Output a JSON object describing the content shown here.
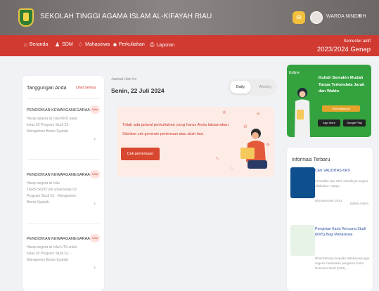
{
  "header": {
    "campus_name": "SEKOLAH TINGGI AGAMA ISLAM AL-KIFAYAH RIAU",
    "user_name": "WARDA NINGSIH",
    "dropdown_icon": "chevron-down-icon"
  },
  "nav": {
    "items": [
      {
        "label": "Beranda",
        "icon": "home-icon"
      },
      {
        "label": "SDM",
        "icon": "person-icon"
      },
      {
        "label": "Mahasiswa",
        "icon": "users-icon"
      },
      {
        "label": "Perkuliahan",
        "icon": "graduation-cap-icon"
      },
      {
        "label": "Laporan",
        "icon": "printer-icon"
      }
    ],
    "semester_label": "Semester aktif",
    "semester_value": "2023/2024 Genap"
  },
  "tanggungan": {
    "title": "Tanggungan Anda",
    "link": "Lihat Semua",
    "items": [
      {
        "name": "PENDIDIKAN KEWARGANEGARAAN",
        "desc": "Harap segera isi nilai MKD pada kelas 02 Program Studi S1 - Manajemen Bisnis Syariah",
        "badge": "Nilai"
      },
      {
        "name": "PENDIDIKAN KEWARGANEGARAAN",
        "desc": "Harap segera isi nilai TERSTRUKTUR untuk kelas 02 Program Studi S1 - Manajemen Bisnis Syariah",
        "badge": "Nilai"
      },
      {
        "name": "PENDIDIKAN KEWARGANEGARAAN",
        "desc": "Harap segera isi nilai UTS untuk kelas 02 Program Studi S1 - Manajemen Bisnis Syariah",
        "badge": "Nilai"
      }
    ]
  },
  "jadwal": {
    "label": "Jadwal Hari Ini",
    "date": "Senin, 22 Juli 2024",
    "toggle": [
      "Daily",
      "Weekly"
    ],
    "empty_title": "Tidak ada jadwal perkuliahan yang harus Anda laksanakan.",
    "empty_sub": "Silahkan cek generate pertemuan atau ubah hari.",
    "button": "Cek pertemuan"
  },
  "banner": {
    "logo": "Edlink",
    "title": "Kuliah Semakin Mudah Tanpa Terkendala Jarak dan Waktu",
    "button": "Selengkapnya",
    "app_store": "App Store",
    "google_play": "Google Play"
  },
  "informasi": {
    "title": "Informasi Terbaru",
    "items": [
      {
        "title": "CEK VALIDITAS KRS",
        "summary": "Perwalian dan KRS sebaiknya segera dilakukan. Harap...",
        "date": "06 Desember 2023",
        "by": "Edlink Admin"
      },
      {
        "title": "Pengisian Kartu Rencana Studi (KRS) Bagi Mahasiswa",
        "summary": "Diberitahukan kepada Mahasiswa agar segera melakukan pengisian Kartu Rencana Studi (KRS)...",
        "date": "",
        "by": ""
      }
    ]
  }
}
